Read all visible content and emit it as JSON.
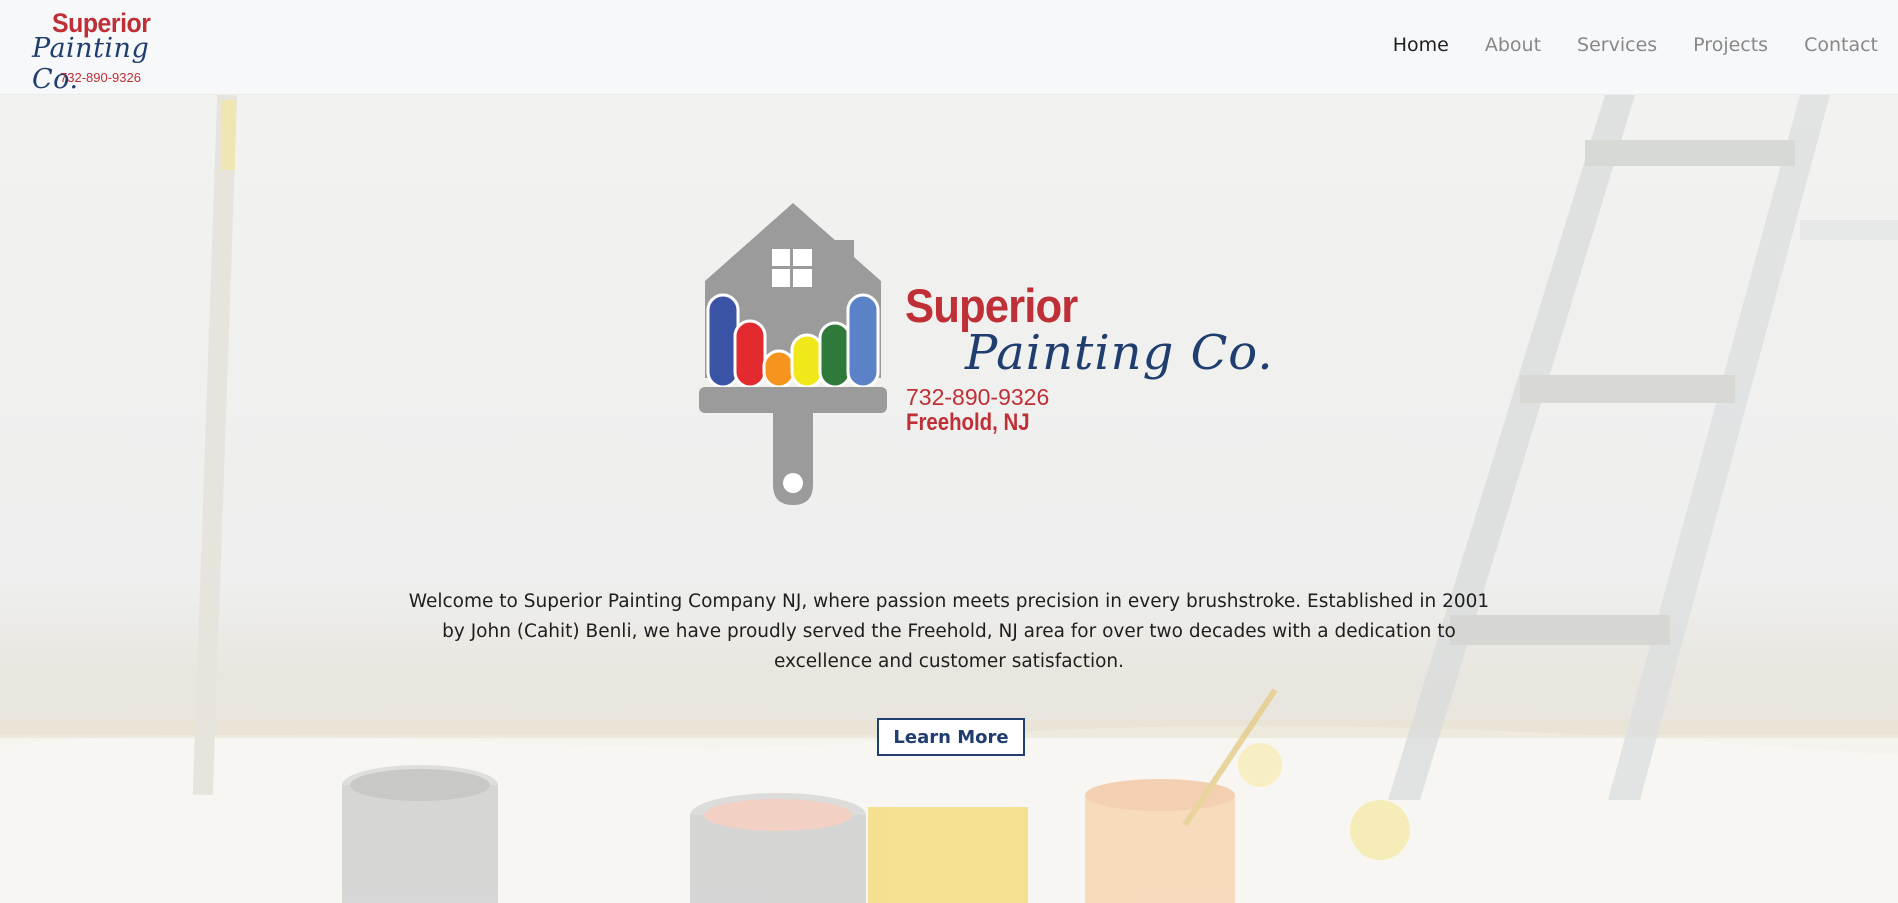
{
  "header": {
    "logo": {
      "brand_top": "Superior",
      "brand_script": "Painting Co.",
      "phone": "732-890-9326"
    },
    "nav": [
      {
        "label": "Home",
        "active": true
      },
      {
        "label": "About",
        "active": false
      },
      {
        "label": "Services",
        "active": false
      },
      {
        "label": "Projects",
        "active": false
      },
      {
        "label": "Contact",
        "active": false
      }
    ]
  },
  "hero": {
    "logo": {
      "brand_top": "Superior",
      "brand_script": "Painting Co.",
      "phone": "732-890-9326",
      "location": "Freehold, NJ",
      "stripe_colors": [
        "#3a53a4",
        "#e32b2f",
        "#f7941d",
        "#f1e81a",
        "#2f7a3a",
        "#5b82c7"
      ]
    },
    "welcome_text": "Welcome to Superior Painting Company NJ, where passion meets precision in every brushstroke. Established in 2001 by John (Cahit) Benli, we have proudly served the Freehold, NJ area for over two decades with a dedication to excellence and customer satisfaction.",
    "cta_label": "Learn More"
  },
  "colors": {
    "brand_red": "#bf2f36",
    "brand_navy": "#1f3d6e",
    "header_bg": "#f7f8fa"
  }
}
